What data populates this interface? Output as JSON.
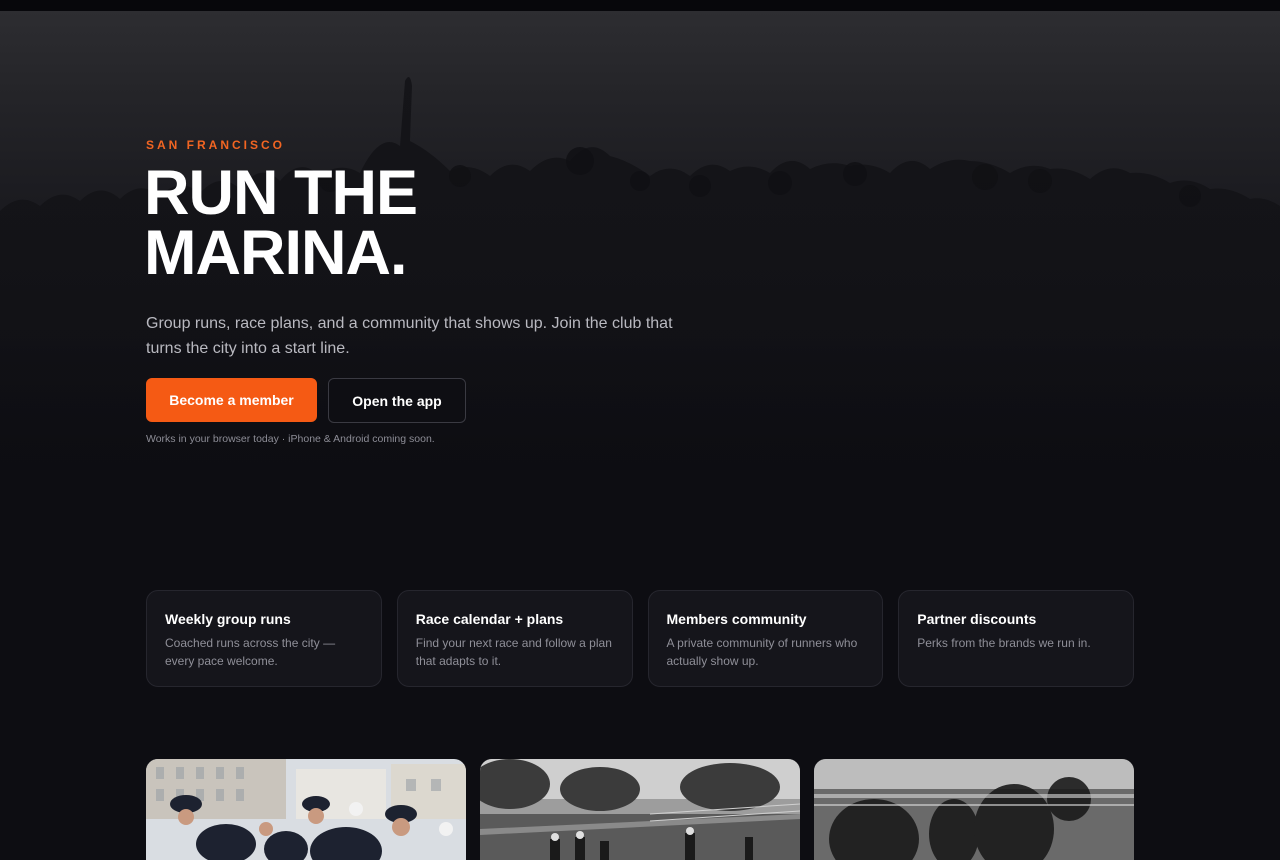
{
  "hero": {
    "kicker": "SAN FRANCISCO",
    "headline_line1": "RUN THE",
    "headline_line2": "MARINA.",
    "subtitle": "Group runs, race plans, and a community that shows up. Join the club that turns the city into a start line.",
    "primary_button": "Become a member",
    "secondary_button": "Open the app",
    "note": "Works in your browser today · iPhone & Android coming soon."
  },
  "features": [
    {
      "title": "Weekly group runs",
      "text": "Coached runs across the city — every pace welcome."
    },
    {
      "title": "Race calendar + plans",
      "text": "Find your next race and follow a plan that adapts to it."
    },
    {
      "title": "Members community",
      "text": "A private community of runners who actually show up."
    },
    {
      "title": "Partner discounts",
      "text": "Perks from the brands we run in."
    }
  ],
  "colors": {
    "accent": "#f55a14",
    "background": "#0d0d12",
    "card": "#15151b"
  }
}
